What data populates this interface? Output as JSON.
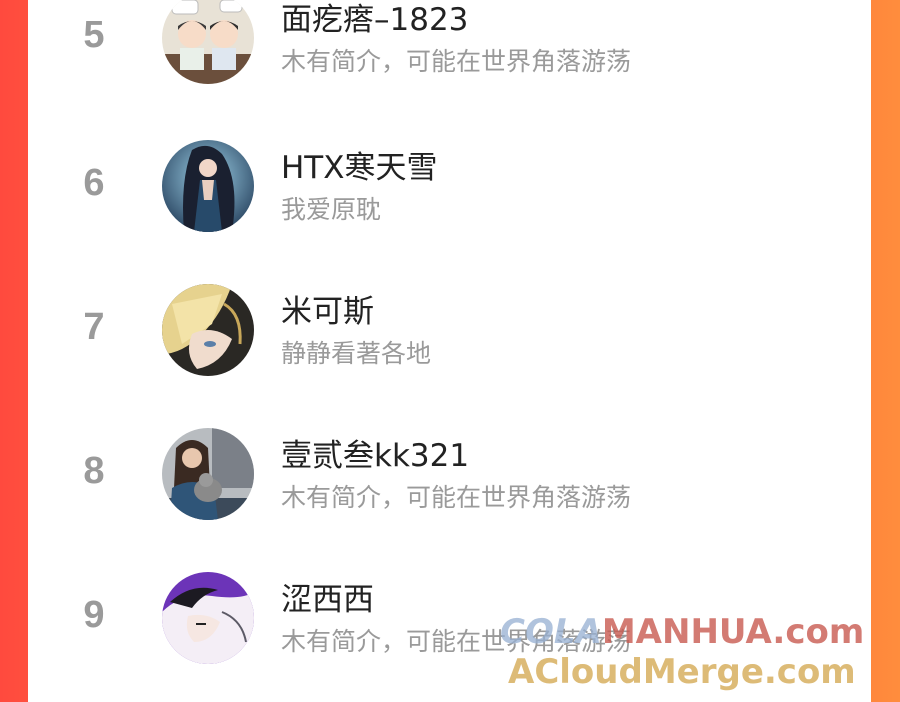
{
  "ranking": [
    {
      "rank": "5",
      "name": "面疙瘩–1823",
      "bio": "木有简介，可能在世界角落游荡",
      "avatar": "two-chibi-characters-avatar"
    },
    {
      "rank": "6",
      "name": "HTX寒天雪",
      "bio": "我爱原耽",
      "avatar": "dark-haired-woman-in-blue-dress-avatar"
    },
    {
      "rank": "7",
      "name": "米可斯",
      "bio": "静静看著各地",
      "avatar": "blonde-anime-character-avatar"
    },
    {
      "rank": "8",
      "name": "壹贰叁kk321",
      "bio": "木有简介，可能在世界角落游荡",
      "avatar": "woman-holding-cat-avatar"
    },
    {
      "rank": "9",
      "name": "涩西西",
      "bio": "木有简介，可能在世界角落游荡",
      "avatar": "sleeping-manga-boy-purple-avatar"
    }
  ],
  "watermark": {
    "line1_prefix": "COLA",
    "line1_suffix": "MANHUA.com",
    "line2": "ACloudMerge.com"
  },
  "colors": {
    "background_gradient_start": "#ff4a3e",
    "background_gradient_end": "#ff8d3d",
    "rank_number": "#9a9a9a",
    "name_text": "#222222",
    "bio_text": "#9a9a9a"
  }
}
